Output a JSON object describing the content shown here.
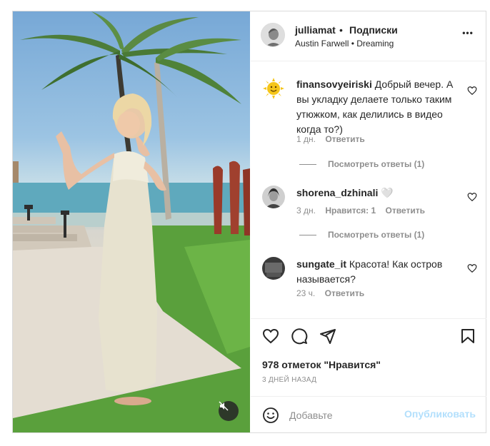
{
  "header": {
    "username": "julliamat",
    "separator": "•",
    "follow_label": "Подписки",
    "music": "Austin Farwell • Dreaming",
    "more_label": "•••",
    "avatar_icon": "avatar-photo"
  },
  "comments": [
    {
      "username": "finansovyeiriski",
      "text": "Добрый вечер. А вы укладку делаете только таким утюжком, как делились в видео когда то?)",
      "time": "1 дн.",
      "likes": "",
      "reply_label": "Ответить",
      "view_replies": "Посмотреть ответы (1)",
      "avatar_icon": "sun-emoji-avatar"
    },
    {
      "username": "shorena_dzhinali",
      "text": "🤍",
      "time": "3 дн.",
      "likes": "Нравится: 1",
      "reply_label": "Ответить",
      "view_replies": "Посмотреть ответы (1)",
      "avatar_icon": "avatar-photo"
    },
    {
      "username": "sungate_it",
      "text": "Красота! Как остров называется?",
      "time": "23 ч.",
      "likes": "",
      "reply_label": "Ответить",
      "view_replies": "",
      "avatar_icon": "avatar-photo"
    }
  ],
  "actions": {
    "likes_count": "978 отметок \"Нравится\"",
    "date": "3 ДНЕЙ НАЗАД",
    "icons": [
      "heart-icon",
      "comment-icon",
      "share-icon",
      "bookmark-icon"
    ]
  },
  "add_comment": {
    "placeholder": "Добавьте",
    "publish_label": "Опубликовать"
  },
  "colors": {
    "text": "#262626",
    "muted": "#8e8e8e",
    "publish_disabled": "#b2dffc",
    "border": "#dbdbdb"
  }
}
